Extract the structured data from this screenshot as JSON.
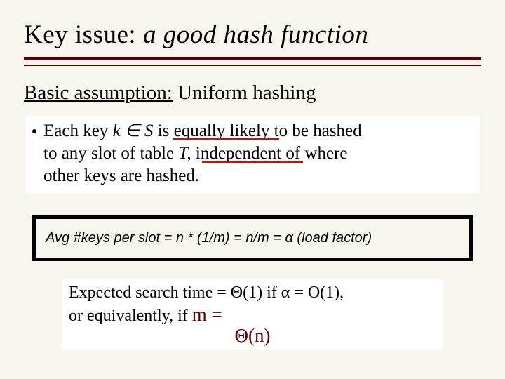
{
  "title": {
    "prefix": "Key issue: ",
    "emph": "a good hash function"
  },
  "assumption": {
    "label": "Basic assumption:",
    "text": "  Uniform hashing"
  },
  "bullet": {
    "pre": "Each key ",
    "kinS": "k ∈ S",
    "mid1": "  is ",
    "equally": "equally likely",
    "mid2": " to be hashed",
    "line2a": "to any slot of table ",
    "Tcomma": "T, ",
    "indep": "independent",
    "line2b": " of where",
    "line3": "other keys are hashed."
  },
  "box": {
    "text": "Avg #keys per slot = n * (1/m)  = n/m = α  (load factor)"
  },
  "expected": {
    "row": "Expected search time = Θ(1) if α = O(1),",
    "row2": "or equivalently, if ",
    "m_eq": "m =",
    "theta_n": "Θ(n)"
  }
}
